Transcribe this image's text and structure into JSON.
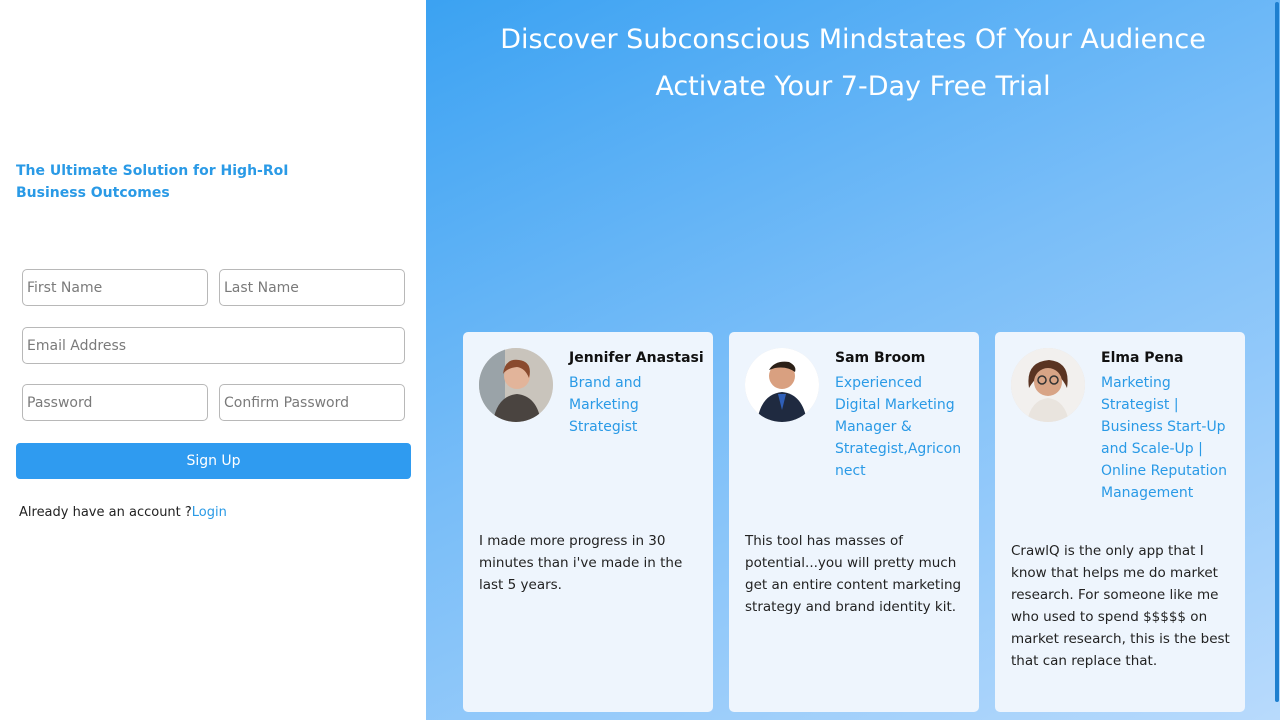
{
  "left": {
    "tagline": "The Ultimate Solution for High-RoI Business Outcomes",
    "form": {
      "first_name_placeholder": "First Name",
      "last_name_placeholder": "Last Name",
      "email_placeholder": "Email Address",
      "password_placeholder": "Password",
      "confirm_password_placeholder": "Confirm Password",
      "signup_label": "Sign Up"
    },
    "login_prompt": "Already have an account ?",
    "login_link": "Login"
  },
  "right": {
    "headline": "Discover Subconscious Mindstates Of Your Audience",
    "subheadline": "Activate Your 7-Day Free Trial",
    "testimonials": [
      {
        "name": "Jennifer Anastasi",
        "role": "Brand and Marketing Strategist",
        "quote": "I made more progress in 30 minutes than i've made in the last 5 years."
      },
      {
        "name": "Sam Broom",
        "role": "Experienced Digital Marketing Manager & Strategist,Agriconnect",
        "quote": "This tool has masses of potential...you will pretty much get an entire content marketing strategy and brand identity kit."
      },
      {
        "name": "Elma Pena",
        "role": "Marketing Strategist | Business Start-Up and Scale-Up | Online Reputation Management",
        "quote": "CrawlQ is the only app that I know that helps me do market research. For someone like me who used to spend $$$$$ on market research, this is the best that can replace that."
      }
    ]
  },
  "colors": {
    "accent": "#2f9bf0",
    "link": "#2a9ae6",
    "card_bg": "#eef5fd",
    "gradient_start": "#3ba2f2",
    "gradient_end": "#b8dafc"
  }
}
